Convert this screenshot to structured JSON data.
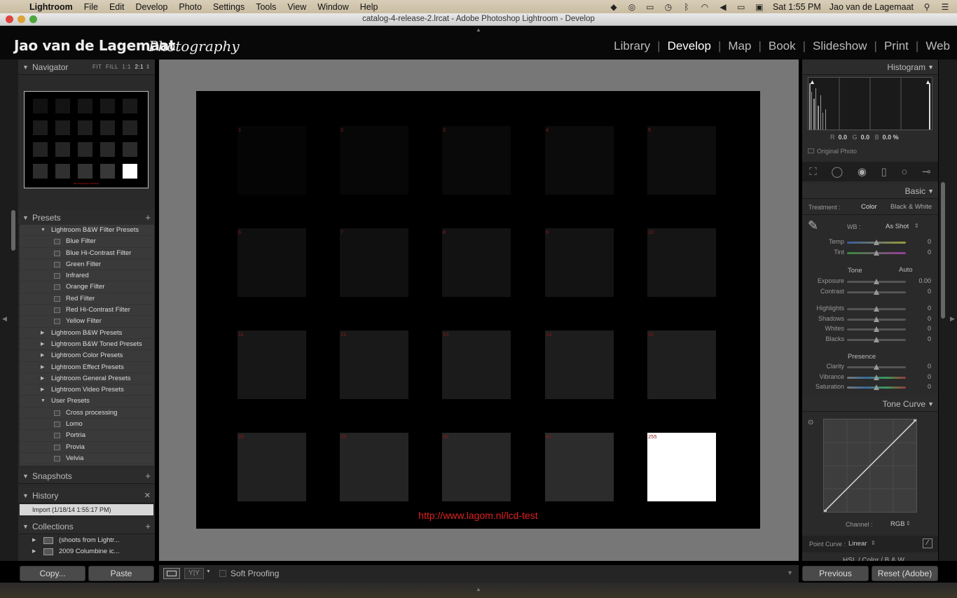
{
  "menubar": {
    "app": "Lightroom",
    "items": [
      "File",
      "Edit",
      "Develop",
      "Photo",
      "Settings",
      "Tools",
      "View",
      "Window",
      "Help"
    ],
    "clock": "Sat 1:55 PM",
    "user": "Jao van de Lagemaat"
  },
  "window": {
    "title": "catalog-4-release-2.lrcat - Adobe Photoshop Lightroom - Develop"
  },
  "identity": {
    "name": "Jao van de Lagemaat",
    "suffix": "Photography"
  },
  "modules": [
    "Library",
    "Develop",
    "Map",
    "Book",
    "Slideshow",
    "Print",
    "Web"
  ],
  "active_module": "Develop",
  "left": {
    "navigator": {
      "title": "Navigator",
      "zoom": [
        "FIT",
        "FILL",
        "1:1",
        "2:1"
      ]
    },
    "presets": {
      "title": "Presets",
      "rows": [
        {
          "label": "Lightroom B&W Filter Presets",
          "type": "folder-open"
        },
        {
          "label": "Blue Filter",
          "type": "item"
        },
        {
          "label": "Blue Hi-Contrast Filter",
          "type": "item"
        },
        {
          "label": "Green Filter",
          "type": "item"
        },
        {
          "label": "Infrared",
          "type": "item"
        },
        {
          "label": "Orange Filter",
          "type": "item"
        },
        {
          "label": "Red Filter",
          "type": "item"
        },
        {
          "label": "Red Hi-Contrast Filter",
          "type": "item"
        },
        {
          "label": "Yellow Filter",
          "type": "item"
        },
        {
          "label": "Lightroom B&W Presets",
          "type": "folder"
        },
        {
          "label": "Lightroom B&W Toned Presets",
          "type": "folder"
        },
        {
          "label": "Lightroom Color Presets",
          "type": "folder"
        },
        {
          "label": "Lightroom Effect Presets",
          "type": "folder"
        },
        {
          "label": "Lightroom General Presets",
          "type": "folder"
        },
        {
          "label": "Lightroom Video Presets",
          "type": "folder"
        },
        {
          "label": "User Presets",
          "type": "folder-open"
        },
        {
          "label": "Cross processing",
          "type": "item"
        },
        {
          "label": "Lomo",
          "type": "item"
        },
        {
          "label": "Portria",
          "type": "item"
        },
        {
          "label": "Provia",
          "type": "item"
        },
        {
          "label": "Velvia",
          "type": "item"
        }
      ]
    },
    "snapshots": {
      "title": "Snapshots"
    },
    "history": {
      "title": "History",
      "entry": "Import (1/18/14 1:55:17 PM)"
    },
    "collections": {
      "title": "Collections",
      "items": [
        "(shoots from Lightr...",
        "2009 Columbine ic..."
      ]
    },
    "copy_label": "Copy...",
    "paste_label": "Paste"
  },
  "photo": {
    "patches": [
      {
        "num": "1",
        "gray": 5
      },
      {
        "num": "2",
        "gray": 7
      },
      {
        "num": "3",
        "gray": 9
      },
      {
        "num": "4",
        "gray": 11
      },
      {
        "num": "5",
        "gray": 13
      },
      {
        "num": "6",
        "gray": 15
      },
      {
        "num": "7",
        "gray": 16
      },
      {
        "num": "8",
        "gray": 18
      },
      {
        "num": "9",
        "gray": 19
      },
      {
        "num": "10",
        "gray": 21
      },
      {
        "num": "11",
        "gray": 23
      },
      {
        "num": "12",
        "gray": 25
      },
      {
        "num": "13",
        "gray": 27
      },
      {
        "num": "14",
        "gray": 29
      },
      {
        "num": "15",
        "gray": 31
      },
      {
        "num": "20",
        "gray": 33
      },
      {
        "num": "25",
        "gray": 36
      },
      {
        "num": "30",
        "gray": 39
      },
      {
        "num": "40",
        "gray": 44
      },
      {
        "num": "255",
        "gray": 255
      }
    ],
    "url": "http://www.lagom.nl/lcd-test"
  },
  "toolbar": {
    "soft_proofing": "Soft Proofing"
  },
  "right": {
    "histogram": {
      "title": "Histogram",
      "r_label": "R",
      "r": "0.0",
      "g_label": "G",
      "g": "0.0",
      "b_label": "B",
      "b": "0.0 %",
      "original": "Original Photo"
    },
    "basic": {
      "title": "Basic",
      "treatment_label": "Treatment :",
      "treatment_color": "Color",
      "treatment_bw": "Black & White",
      "wb_label": "WB :",
      "wb_value": "As Shot",
      "tone_label": "Tone",
      "auto_label": "Auto",
      "presence_label": "Presence",
      "sliders": [
        {
          "name": "Temp",
          "value": "0",
          "group": "wb"
        },
        {
          "name": "Tint",
          "value": "0",
          "group": "wb"
        },
        {
          "name": "Exposure",
          "value": "0.00",
          "group": "tone"
        },
        {
          "name": "Contrast",
          "value": "0",
          "group": "tone"
        },
        {
          "name": "Highlights",
          "value": "0",
          "group": "tone2"
        },
        {
          "name": "Shadows",
          "value": "0",
          "group": "tone2"
        },
        {
          "name": "Whites",
          "value": "0",
          "group": "tone2"
        },
        {
          "name": "Blacks",
          "value": "0",
          "group": "tone2"
        },
        {
          "name": "Clarity",
          "value": "0",
          "group": "presence"
        },
        {
          "name": "Vibrance",
          "value": "0",
          "group": "presence"
        },
        {
          "name": "Saturation",
          "value": "0",
          "group": "presence"
        }
      ]
    },
    "tonecurve": {
      "title": "Tone Curve",
      "channel_label": "Channel :",
      "channel": "RGB",
      "point_label": "Point Curve :",
      "point": "Linear"
    },
    "hsl_partial": "HSL / Color / B & W",
    "previous_label": "Previous",
    "reset_label": "Reset (Adobe)"
  }
}
